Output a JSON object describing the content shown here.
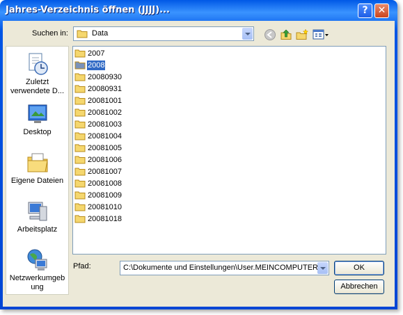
{
  "window": {
    "title": "Jahres-Verzeichnis öffnen (JJJJ)...",
    "help_glyph": "?",
    "close_glyph": "✕"
  },
  "lookin": {
    "label": "Suchen in:",
    "value": "Data"
  },
  "places": [
    {
      "label": "Zuletzt verwendete D...",
      "icon": "recent-documents-icon"
    },
    {
      "label": "Desktop",
      "icon": "desktop-icon"
    },
    {
      "label": "Eigene Dateien",
      "icon": "my-documents-icon"
    },
    {
      "label": "Arbeitsplatz",
      "icon": "my-computer-icon"
    },
    {
      "label": "Netzwerkumgeb ung",
      "icon": "network-places-icon"
    }
  ],
  "folders": [
    "2007",
    "2008",
    "20080930",
    "20080931",
    "20081001",
    "20081002",
    "20081003",
    "20081004",
    "20081005",
    "20081006",
    "20081007",
    "20081008",
    "20081009",
    "20081010",
    "20081018"
  ],
  "selected_folder": "2008",
  "path": {
    "label": "Pfad:",
    "value": "C:\\Dokumente und Einstellungen\\User.MEINCOMPUTER\\A"
  },
  "buttons": {
    "ok": "OK",
    "cancel": "Abbrechen"
  },
  "colors": {
    "selection": "#316ac5",
    "titlebar": "#0055e5",
    "dialog_bg": "#ece9d8",
    "folder": "#f5d76e"
  }
}
